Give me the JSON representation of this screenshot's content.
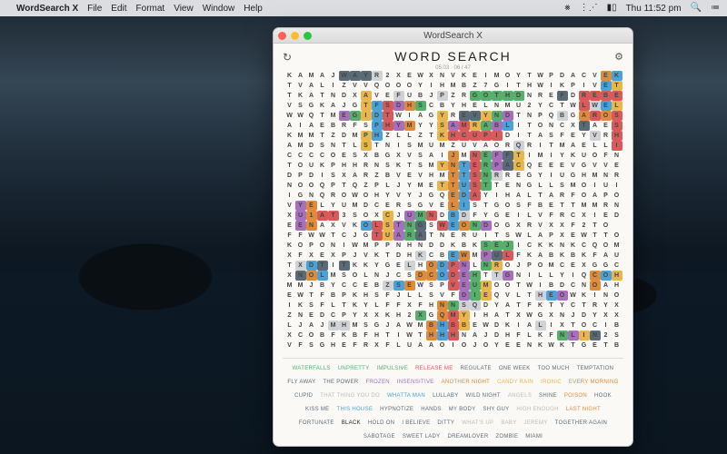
{
  "menubar": {
    "app": "WordSearch X",
    "items": [
      "File",
      "Edit",
      "Format",
      "View",
      "Window",
      "Help"
    ],
    "clock": "Thu 11:52 pm"
  },
  "window": {
    "title": "WordSearch X",
    "heading": "WORD SEARCH",
    "sub": "05:03  ·  06 / 47"
  },
  "grid": {
    "rows": [
      "KAMAJWAYR2XEWXNVKEIMOYTWPDACVEK",
      "TVALIZVVQOOOYIHMBZ7GITHWIKPIVET",
      "TKATNDXAVEFUBJPZRGOTHDNREFDREBE",
      "VSGKAJGTFSDHSCBYHELNMU2YCTWLWEL",
      "WWQTMEGIDTWIAGYREVYNDTNPQBGAROS",
      "AIAEBRFSPHYMYYSAMRABLITONCXTAES",
      "KMMTZDMPHZLLZTKHCUPIDITASFEYVRH",
      "AMDSNTLSTNISMUMZUVAORQRITMAELLI",
      "CCCCOESXBGXVSAIJMNEFFTIMIYKUOFN",
      "TOUKPHHRNSKTSMYNTERPACQEEEVGVVE",
      "DPDISXARZBVEVHMTTSNRREGYIUGHMNR",
      "NOOQPTQZPLJYMETTUSTTENGLLSMOIUI",
      "IGNQROWOHYVYJGQEDAYIHALTARFOAPO",
      "VYELYUMDCERSGVELISTGOSFBETTMMRN",
      "XU1AT3SOXCJUMNDBDFYGEILVFRCXIED",
      "EENAXVKOLSTNGSWEONDOGXRVXXF2TO",
      "FFWWTCJGTUARATNERUITSWLAPXEWTTO",
      "KOPONIWMPPNHNDDKBKSEJICKKNKCQOM",
      "XFXEXPJVKTDHKCBEWMPULFKABKBKFAU",
      "TXDTITKKYGELHODPNLNROJPOMCEXGGC",
      "XNOLMSOLNJCSDCODEHTTGNILLYIQCOH",
      "MMJBYCCEBZSEWSPVEUMOOTWIBDCNOAH",
      "EWTFBPKHSFJLLSVFDIEQVLTHEOWKINO",
      "IKSFLTKYLFFXFHNNSQDYATFKTYCTRYX",
      "ZNEDCPYXXKH2XGQMYIHATXWGXNJDYXX",
      "LJAJMHMSGJAWMBHBBEWDKIALIXTOCIB",
      "XCOBFKBFHTIWTHHHNAJDHFLKFNLIN2S",
      "VFSGHEFRXFLUAAOIOJOYEENKWKTGETB"
    ],
    "hl": {
      "0": {
        "5": "#5a6b78",
        "6": "#5a6b78",
        "7": "#5a6b78",
        "8": "#cfd3d6",
        "29": "#e08b3a",
        "30": "#4aa3d8"
      },
      "1": {
        "29": "#4aa3d8",
        "30": "#e8b64b"
      },
      "2": {
        "7": "#e8b64b",
        "10": "#cfd3d6",
        "14": "#cfd3d6",
        "17": "#54b06a",
        "18": "#54b06a",
        "19": "#54b06a",
        "20": "#54b06a",
        "21": "#54b06a",
        "25": "#5a6b78",
        "27": "#d85a5a",
        "28": "#d85a5a",
        "29": "#d85a5a",
        "30": "#d85a5a"
      },
      "3": {
        "7": "#e8b64b",
        "8": "#4aa3d8",
        "9": "#d85a5a",
        "10": "#a86fbf",
        "11": "#e08b3a",
        "12": "#54b06a",
        "27": "#d85a5a",
        "28": "#cfd3d6",
        "29": "#4aa3d8",
        "30": "#e8b64b"
      },
      "4": {
        "5": "#a86fbf",
        "6": "#54b06a",
        "7": "#e8b64b",
        "8": "#4aa3d8",
        "9": "#d85a5a",
        "14": "#e8b64b",
        "16": "#5a6b78",
        "17": "#5a6b78",
        "18": "#e8b64b",
        "19": "#54b06a",
        "20": "#a86fbf",
        "25": "#cfd3d6",
        "27": "#e08b3a",
        "28": "#d85a5a",
        "29": "#e08b3a",
        "30": "#d85a5a"
      },
      "5": {
        "8": "#4aa3d8",
        "9": "#d85a5a",
        "10": "#a86fbf",
        "11": "#e08b3a",
        "14": "#e8b64b",
        "15": "#a86fbf",
        "16": "#d85a5a",
        "17": "#e8b64b",
        "18": "#54b06a",
        "19": "#a86fbf",
        "20": "#4aa3d8",
        "27": "#5a6b78",
        "30": "#d85a5a"
      },
      "6": {
        "7": "#e8b64b",
        "8": "#4aa3d8",
        "14": "#e8b64b",
        "15": "#d85a5a",
        "16": "#d85a5a",
        "17": "#d85a5a",
        "18": "#d85a5a",
        "19": "#d85a5a",
        "28": "#cfd3d6",
        "30": "#d85a5a"
      },
      "7": {
        "7": "#e8b64b",
        "21": "#cfd3d6",
        "30": "#d85a5a"
      },
      "8": {
        "15": "#e08b3a",
        "17": "#d85a5a",
        "18": "#54b06a",
        "19": "#a86fbf",
        "20": "#5a6b78",
        "21": "#e8b64b"
      },
      "9": {
        "14": "#e8b64b",
        "15": "#e08b3a",
        "16": "#4aa3d8",
        "17": "#d85a5a",
        "18": "#54b06a",
        "19": "#a86fbf",
        "20": "#5a6b78",
        "21": "#e8b64b"
      },
      "10": {
        "15": "#e08b3a",
        "16": "#4aa3d8",
        "17": "#d85a5a",
        "18": "#54b06a",
        "19": "#cfd3d6"
      },
      "11": {
        "14": "#e8b64b",
        "15": "#e08b3a",
        "16": "#4aa3d8",
        "17": "#d85a5a",
        "18": "#54b06a"
      },
      "12": {
        "15": "#e08b3a",
        "16": "#4aa3d8",
        "17": "#d85a5a"
      },
      "13": {
        "1": "#a86fbf",
        "2": "#e08b3a",
        "15": "#e08b3a",
        "16": "#4aa3d8"
      },
      "14": {
        "1": "#a86fbf",
        "2": "#e08b3a",
        "3": "#d85a5a",
        "4": "#d85a5a",
        "9": "#e8b64b",
        "11": "#a86fbf",
        "12": "#54b06a",
        "13": "#d85a5a",
        "15": "#4aa3d8",
        "16": "#cfd3d6"
      },
      "15": {
        "1": "#a86fbf",
        "2": "#e08b3a",
        "7": "#4aa3d8",
        "8": "#d85a5a",
        "9": "#e8b64b",
        "10": "#a86fbf",
        "11": "#54b06a",
        "12": "#5a6b78",
        "14": "#d85a5a",
        "15": "#4aa3d8",
        "16": "#e08b3a",
        "17": "#54b06a",
        "18": "#a86fbf"
      },
      "16": {
        "8": "#d85a5a",
        "9": "#e8b64b",
        "10": "#a86fbf",
        "11": "#54b06a",
        "12": "#5a6b78"
      },
      "17": {
        "18": "#54b06a",
        "19": "#54b06a",
        "20": "#54b06a"
      },
      "18": {
        "12": "#cfd3d6",
        "15": "#4aa3d8",
        "16": "#e08b3a",
        "18": "#a86fbf",
        "19": "#5a6b78",
        "20": "#d85a5a"
      },
      "19": {
        "1": "#cfd3d6",
        "2": "#4aa3d8",
        "3": "#5a6b78",
        "5": "#5a6b78",
        "11": "#cfd3d6",
        "13": "#e08b3a",
        "14": "#4aa3d8",
        "15": "#d85a5a",
        "16": "#a86fbf",
        "18": "#54b06a",
        "19": "#e8b64b"
      },
      "20": {
        "1": "#5a6b78",
        "2": "#e08b3a",
        "3": "#4aa3d8",
        "12": "#e08b3a",
        "13": "#e08b3a",
        "14": "#4aa3d8",
        "15": "#d85a5a",
        "16": "#a86fbf",
        "17": "#54b06a",
        "19": "#cfd3d6",
        "20": "#a86fbf",
        "28": "#e08b3a",
        "29": "#4aa3d8",
        "30": "#e8b64b"
      },
      "21": {
        "9": "#cfd3d6",
        "10": "#4aa3d8",
        "11": "#e08b3a",
        "15": "#d85a5a",
        "16": "#a86fbf",
        "17": "#54b06a",
        "18": "#e8b64b",
        "28": "#e08b3a"
      },
      "22": {
        "16": "#a86fbf",
        "17": "#54b06a",
        "18": "#e8b64b",
        "23": "#cfd3d6",
        "24": "#4aa3d8",
        "25": "#a86fbf"
      },
      "23": {
        "14": "#e08b3a",
        "15": "#54b06a",
        "16": "#cfd3d6",
        "17": "#cfd3d6"
      },
      "24": {
        "12": "#54b06a",
        "14": "#e08b3a",
        "15": "#d85a5a",
        "16": "#e8b64b"
      },
      "25": {
        "4": "#cfd3d6",
        "5": "#cfd3d6",
        "13": "#e08b3a",
        "14": "#4aa3d8",
        "15": "#d85a5a",
        "16": "#e8b64b",
        "23": "#cfd3d6"
      },
      "26": {
        "13": "#e08b3a",
        "14": "#4aa3d8",
        "15": "#d85a5a",
        "25": "#54b06a",
        "26": "#a86fbf",
        "27": "#e8b64b",
        "28": "#5a6b78"
      },
      "27": {}
    }
  },
  "words": [
    {
      "t": "WATERFALLS",
      "c": "#54b06a"
    },
    {
      "t": "UNPRETTY",
      "c": "#54b06a"
    },
    {
      "t": "IMPULSIVE",
      "c": "#54b06a"
    },
    {
      "t": "RELEASE ME",
      "c": "#d85a5a"
    },
    {
      "t": "REGULATE",
      "c": "#5a6b78"
    },
    {
      "t": "ONE WEEK",
      "c": "#5a6b78"
    },
    {
      "t": "TOO MUCH",
      "c": "#5a6b78"
    },
    {
      "t": "TEMPTATION",
      "c": "#5a6b78"
    },
    {
      "t": "FLY AWAY",
      "c": "#5a6b78"
    },
    {
      "t": "THE POWER",
      "c": "#5a6b78"
    },
    {
      "t": "FROZEN",
      "c": "#a86fbf"
    },
    {
      "t": "INSENSITIVE",
      "c": "#a86fbf"
    },
    {
      "t": "ANOTHER NIGHT",
      "c": "#e08b3a"
    },
    {
      "t": "CANDY RAIN",
      "c": "#e8b64b",
      "f": true
    },
    {
      "t": "IRONIC",
      "c": "#e8b64b"
    },
    {
      "t": "EVERY MORNING",
      "c": "#e08b3a"
    },
    {
      "t": "CUPID",
      "c": "#5a6b78"
    },
    {
      "t": "THAT THING YOU DO",
      "c": "#bbb",
      "f": true
    },
    {
      "t": "WHATTA MAN",
      "c": "#4aa3d8"
    },
    {
      "t": "LULLABY",
      "c": "#5a6b78"
    },
    {
      "t": "WILD NIGHT",
      "c": "#5a6b78"
    },
    {
      "t": "ANGELS",
      "c": "#bbb",
      "f": true
    },
    {
      "t": "SHINE",
      "c": "#5a6b78"
    },
    {
      "t": "POISON",
      "c": "#e08b3a"
    },
    {
      "t": "HOOK",
      "c": "#5a6b78"
    },
    {
      "t": "KISS ME",
      "c": "#5a6b78"
    },
    {
      "t": "THIS HOUSE",
      "c": "#4aa3d8"
    },
    {
      "t": "HYPNOTIZE",
      "c": "#5a6b78"
    },
    {
      "t": "HANDS",
      "c": "#5a6b78"
    },
    {
      "t": "MY BODY",
      "c": "#5a6b78"
    },
    {
      "t": "SHY GUY",
      "c": "#5a6b78"
    },
    {
      "t": "HIGH ENOUGH",
      "c": "#bbb",
      "f": true
    },
    {
      "t": "LAST NIGHT",
      "c": "#e08b3a"
    },
    {
      "t": "FORTUNATE",
      "c": "#5a6b78"
    },
    {
      "t": "BLACK",
      "c": "#222"
    },
    {
      "t": "HOLD ON",
      "c": "#5a6b78"
    },
    {
      "t": "I BELIEVE",
      "c": "#5a6b78"
    },
    {
      "t": "DITTY",
      "c": "#5a6b78"
    },
    {
      "t": "WHAT'S UP",
      "c": "#bbb",
      "f": true
    },
    {
      "t": "BABY",
      "c": "#bbb",
      "f": true
    },
    {
      "t": "JEREMY",
      "c": "#bbb",
      "f": true
    },
    {
      "t": "TOGETHER AGAIN",
      "c": "#5a6b78"
    },
    {
      "t": "SABOTAGE",
      "c": "#5a6b78"
    },
    {
      "t": "SWEET LADY",
      "c": "#5a6b78"
    },
    {
      "t": "DREAMLOVER",
      "c": "#5a6b78"
    },
    {
      "t": "ZOMBIE",
      "c": "#5a6b78"
    },
    {
      "t": "MIAMI",
      "c": "#5a6b78"
    }
  ]
}
